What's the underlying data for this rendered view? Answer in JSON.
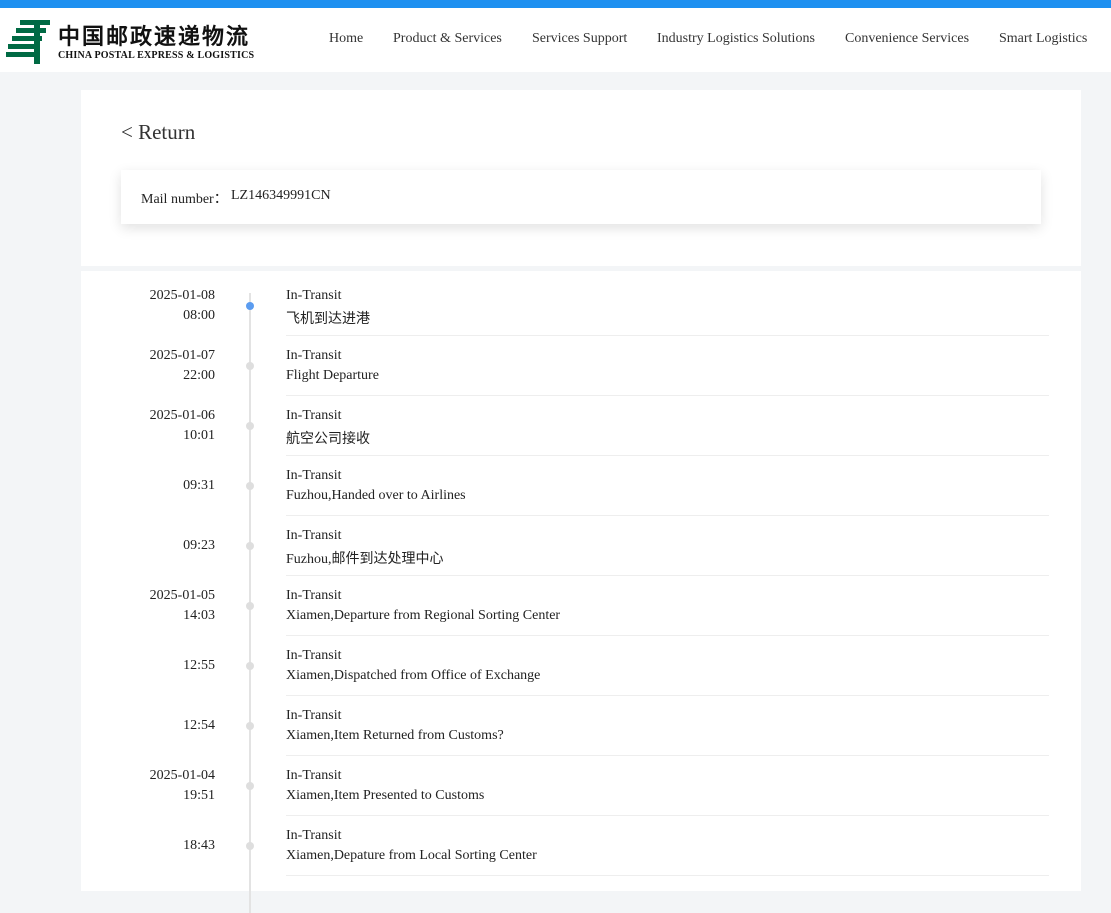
{
  "header": {
    "logo_cn": "中国邮政速递物流",
    "logo_en": "CHINA POSTAL EXPRESS & LOGISTICS",
    "brand_color": "#006a44",
    "accent_color": "#1e90f0",
    "nav": [
      {
        "label": "Home"
      },
      {
        "label": "Product & Services"
      },
      {
        "label": "Services Support"
      },
      {
        "label": "Industry Logistics Solutions"
      },
      {
        "label": "Convenience Services"
      },
      {
        "label": "Smart Logistics"
      }
    ]
  },
  "tracking": {
    "return_label": "< Return",
    "mail_label": "Mail number：",
    "mail_number": "LZ146349991CN"
  },
  "events": [
    {
      "date": "2025-01-08",
      "time": "08:00",
      "status": "In-Transit",
      "desc": "飞机到达进港",
      "active": true
    },
    {
      "date": "2025-01-07",
      "time": "22:00",
      "status": "In-Transit",
      "desc": "Flight Departure"
    },
    {
      "date": "2025-01-06",
      "time": "10:01",
      "status": "In-Transit",
      "desc": "航空公司接收"
    },
    {
      "date": "",
      "time": "09:31",
      "status": "In-Transit",
      "desc": "Fuzhou,Handed over to Airlines"
    },
    {
      "date": "",
      "time": "09:23",
      "status": "In-Transit",
      "desc": "Fuzhou,邮件到达处理中心"
    },
    {
      "date": "2025-01-05",
      "time": "14:03",
      "status": "In-Transit",
      "desc": "Xiamen,Departure from Regional Sorting Center"
    },
    {
      "date": "",
      "time": "12:55",
      "status": "In-Transit",
      "desc": "Xiamen,Dispatched from Office of Exchange"
    },
    {
      "date": "",
      "time": "12:54",
      "status": "In-Transit",
      "desc": "Xiamen,Item Returned from Customs?"
    },
    {
      "date": "2025-01-04",
      "time": "19:51",
      "status": "In-Transit",
      "desc": "Xiamen,Item Presented to Customs"
    },
    {
      "date": "",
      "time": "18:43",
      "status": "In-Transit",
      "desc": "Xiamen,Depature from Local Sorting Center"
    }
  ]
}
